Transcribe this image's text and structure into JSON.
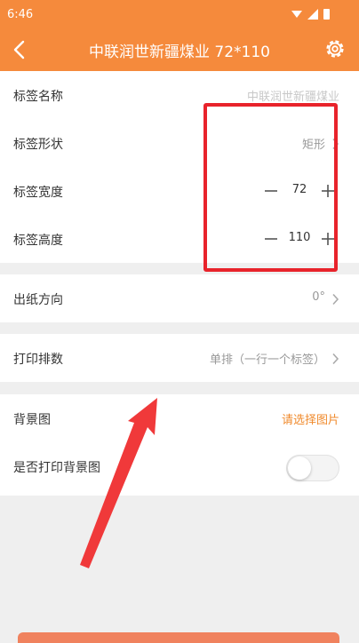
{
  "status_bar": {
    "time": "6:46"
  },
  "header": {
    "title": "中联润世新疆煤业  72*110"
  },
  "label_settings": {
    "name": {
      "label": "标签名称",
      "value": "中联润世新疆煤业"
    },
    "shape": {
      "label": "标签形状",
      "value": "矩形"
    },
    "width": {
      "label": "标签宽度",
      "value": "72"
    },
    "height": {
      "label": "标签高度",
      "value": "110"
    }
  },
  "paper_direction": {
    "label": "出纸方向",
    "value": "0°"
  },
  "print_layout": {
    "label": "打印排数",
    "value": "单排（一行一个标签）"
  },
  "background": {
    "label": "背景图",
    "action": "请选择图片",
    "print_label": "是否打印背景图",
    "print_enabled": false
  },
  "colors": {
    "primary": "#f58a3c",
    "highlight": "#e8232b",
    "action": "#f08a2c"
  },
  "icons": {
    "back": "back-arrow-icon",
    "settings": "gear-icon",
    "chevron": "chevron-right-icon",
    "minus": "minus-icon",
    "plus": "plus-icon"
  }
}
